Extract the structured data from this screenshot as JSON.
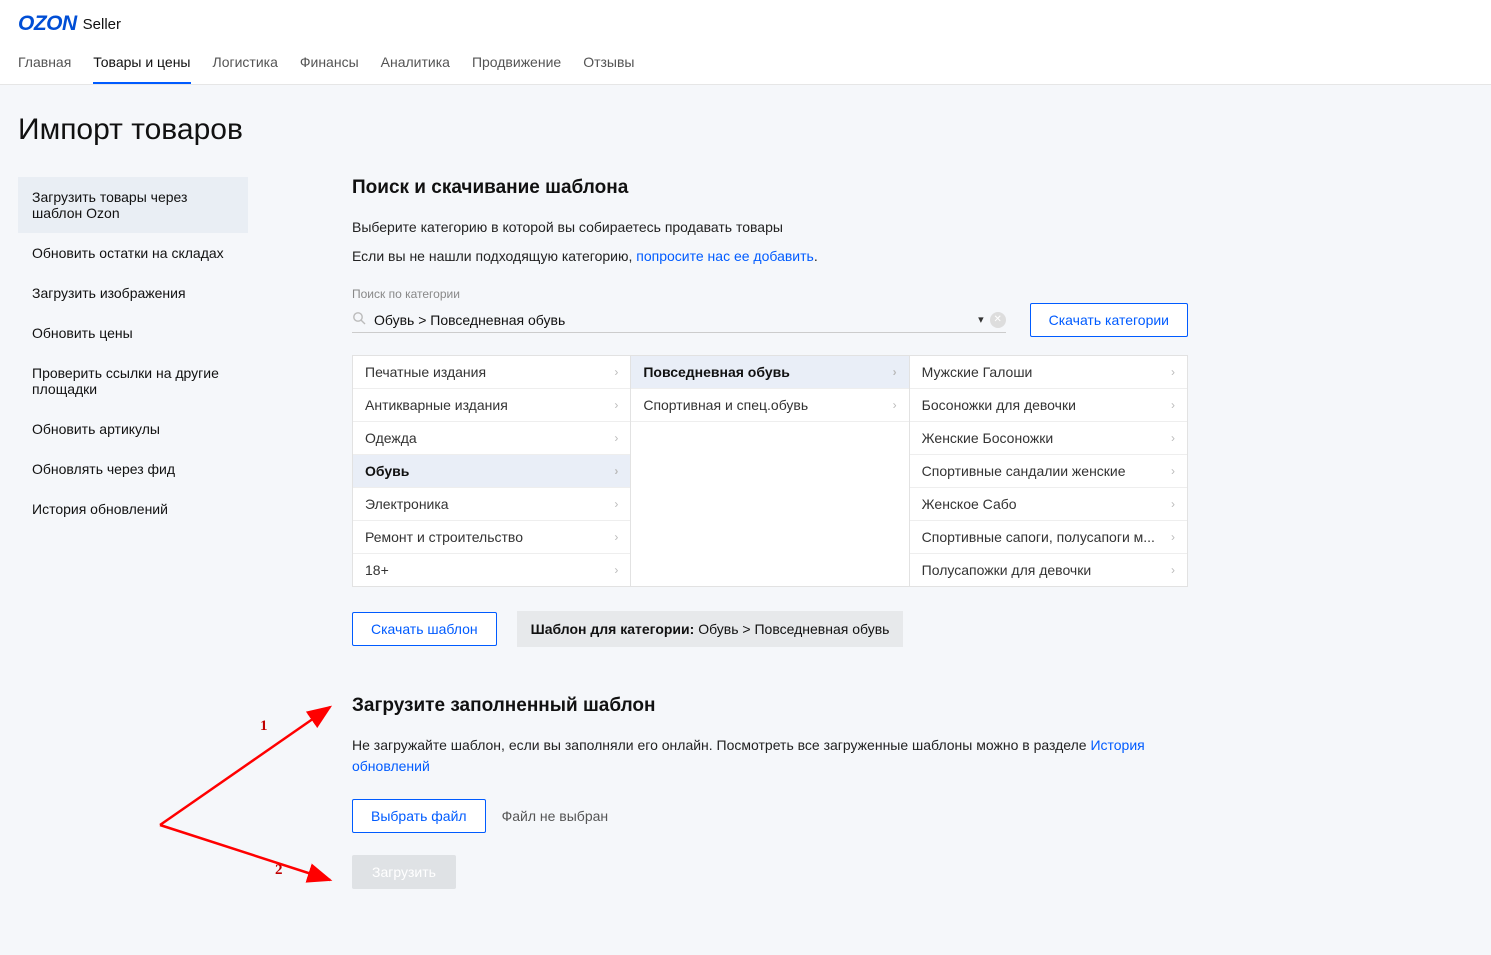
{
  "logo": {
    "brand": "OZON",
    "sub": "Seller"
  },
  "topnav": {
    "items": [
      {
        "label": "Главная"
      },
      {
        "label": "Товары и цены",
        "active": true
      },
      {
        "label": "Логистика"
      },
      {
        "label": "Финансы"
      },
      {
        "label": "Аналитика"
      },
      {
        "label": "Продвижение"
      },
      {
        "label": "Отзывы"
      }
    ]
  },
  "page_title": "Импорт товаров",
  "sidebar": {
    "items": [
      {
        "label": "Загрузить товары через шаблон Ozon",
        "active": true
      },
      {
        "label": "Обновить остатки на складах"
      },
      {
        "label": "Загрузить изображения"
      },
      {
        "label": "Обновить цены"
      },
      {
        "label": "Проверить ссылки на другие площадки"
      },
      {
        "label": "Обновить артикулы"
      },
      {
        "label": "Обновлять через фид"
      },
      {
        "label": "История обновлений"
      }
    ]
  },
  "template_search": {
    "heading": "Поиск и скачивание шаблона",
    "subtitle": "Выберите категорию в которой вы собираетесь продавать товары",
    "not_found_prefix": "Если вы не нашли подходящую категорию, ",
    "not_found_link": "попросите нас ее добавить",
    "not_found_suffix": ".",
    "search_label": "Поиск по категории",
    "search_value": "Обувь > Повседневная обувь",
    "download_categories_btn": "Скачать категории"
  },
  "category_browser": {
    "col1": [
      {
        "label": "Печатные издания"
      },
      {
        "label": "Антикварные издания"
      },
      {
        "label": "Одежда"
      },
      {
        "label": "Обувь",
        "selected": true
      },
      {
        "label": "Электроника"
      },
      {
        "label": "Ремонт и строительство"
      },
      {
        "label": "18+"
      }
    ],
    "col2": [
      {
        "label": "Повседневная обувь",
        "selected": true
      },
      {
        "label": "Спортивная и спец.обувь"
      }
    ],
    "col3": [
      {
        "label": "Мужские Галоши"
      },
      {
        "label": "Босоножки для девочки"
      },
      {
        "label": "Женские Босоножки"
      },
      {
        "label": "Спортивные сандалии женские"
      },
      {
        "label": "Женское Сабо"
      },
      {
        "label": "Спортивные сапоги, полусапоги м..."
      },
      {
        "label": "Полусапожки для девочки"
      }
    ]
  },
  "download_row": {
    "download_btn": "Скачать шаблон",
    "template_label_prefix": "Шаблон для категории:",
    "template_label_value": " Обувь > Повседневная обувь"
  },
  "upload": {
    "heading": "Загрузите заполненный шаблон",
    "desc_prefix": "Не загружайте шаблон, если вы заполняли его онлайн. Посмотреть все загруженные шаблоны можно в разделе ",
    "desc_link": "История обновлений",
    "choose_file_btn": "Выбрать файл",
    "file_status": "Файл не выбран",
    "upload_btn": "Загрузить"
  },
  "annotations": {
    "num1": "1",
    "num2": "2"
  }
}
